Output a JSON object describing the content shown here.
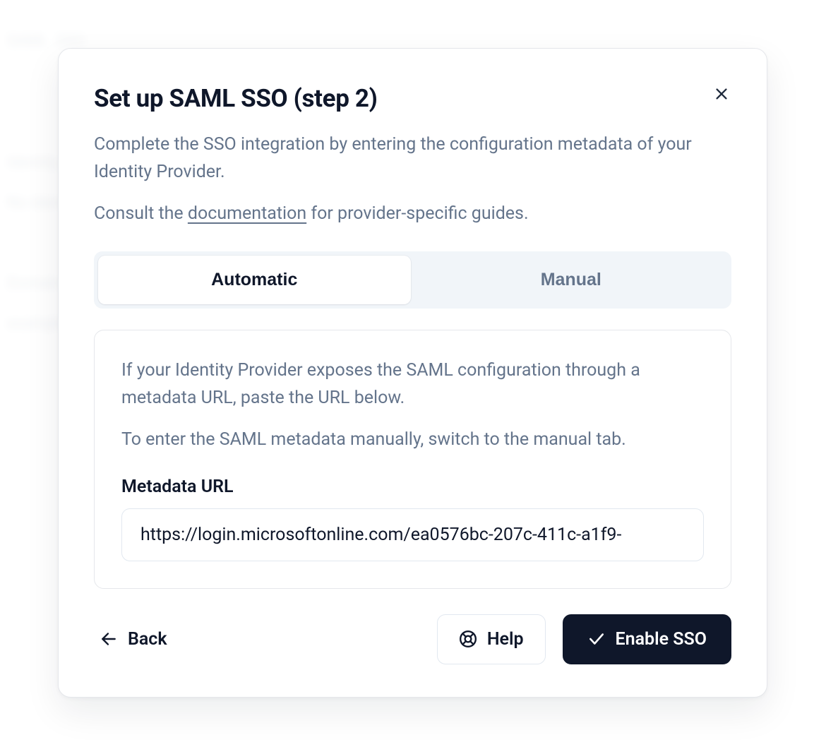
{
  "modal": {
    "title": "Set up SAML SSO (step 2)",
    "description_line1": "Complete the SSO integration by entering the configuration metadata of your Identity Provider.",
    "description_line2_prefix": "Consult the ",
    "documentation_link_label": "documentation",
    "description_line2_suffix": " for provider-specific guides.",
    "tabs": {
      "automatic": "Automatic",
      "manual": "Manual"
    },
    "panel": {
      "desc_line1": "If your Identity Provider exposes the SAML configuration through a metadata URL, paste the URL below.",
      "desc_line2": "To enter the SAML metadata manually, switch to the manual tab.",
      "field_label": "Metadata URL",
      "field_value": "https://login.microsoftonline.com/ea0576bc-207c-411c-a1f9-"
    },
    "footer": {
      "back": "Back",
      "help": "Help",
      "enable": "Enable SSO"
    }
  }
}
